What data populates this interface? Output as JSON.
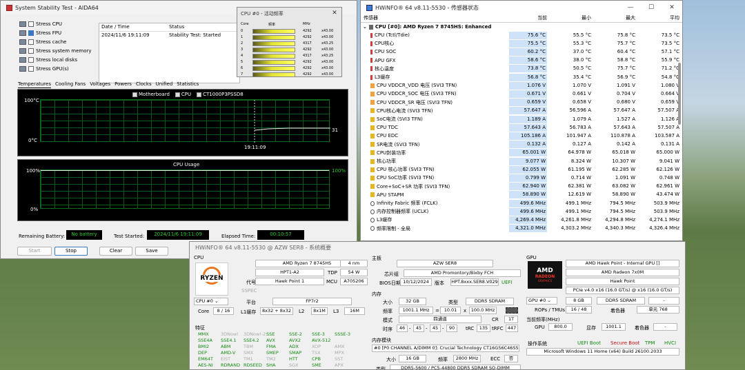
{
  "aida": {
    "title": "System Stability Test - AIDA64",
    "checks": [
      {
        "label": "Stress CPU",
        "on": false
      },
      {
        "label": "Stress FPU",
        "on": true
      },
      {
        "label": "Stress cache",
        "on": false
      },
      {
        "label": "Stress system memory",
        "on": false
      },
      {
        "label": "Stress local disks",
        "on": false
      },
      {
        "label": "Stress GPU(s)",
        "on": false
      }
    ],
    "list_headers": [
      "Date / Time",
      "Status"
    ],
    "list_rows": [
      [
        "2024/11/6 19:11:09",
        "Stability Test: Started"
      ]
    ],
    "tabs": [
      "Temperatures",
      "Cooling Fans",
      "Voltages",
      "Powers",
      "Clocks",
      "Unified",
      "Statistics"
    ],
    "temp_legend": [
      "Motherboard",
      "CPU",
      "CT1000P3PSSD8"
    ],
    "temp_top": "100°C",
    "temp_bottom": "0°C",
    "temp_time": "19:11:09",
    "temp_value": "31",
    "usage_title": "CPU Usage",
    "usage_top": "100%",
    "usage_bottom": "0%",
    "usage_right": "100%",
    "remaining_label": "Remaining Battery:",
    "remaining_value": "No battery",
    "started_label": "Test Started:",
    "started_value": "2024/11/6 19:11:09",
    "elapsed_label": "Elapsed Time:",
    "elapsed_value": "00:10:57",
    "buttons": [
      "Start",
      "Stop",
      "Clear",
      "Save"
    ]
  },
  "cpuact": {
    "title": "CPU #0 - 活动频率",
    "h_core": "Core",
    "h_load": "频率",
    "h_mhz": "MHz",
    "h_ratio": "",
    "rows": [
      [
        "0",
        "4292",
        "x43.00"
      ],
      [
        "1",
        "4292",
        "x43.00"
      ],
      [
        "2",
        "4317",
        "x43.25"
      ],
      [
        "3",
        "4292",
        "x43.00"
      ],
      [
        "4",
        "4317",
        "x43.25"
      ],
      [
        "5",
        "4292",
        "x43.00"
      ],
      [
        "6",
        "4292",
        "x43.00"
      ],
      [
        "7",
        "4292",
        "x43.00"
      ]
    ]
  },
  "hws": {
    "title": "HWiNFO® 64 v8.11-5530 - 传感器状态",
    "headers": [
      "传感器",
      "当前",
      "最小",
      "最大",
      "平均"
    ],
    "group": "CPU [#0]: AMD Ryzen 7 8745HS: Enhanced",
    "rows": [
      [
        "CPU (Tctl/Tdie)",
        "75.6 °C",
        "55.5 °C",
        "75.8 °C",
        "73.5 °C",
        "t"
      ],
      [
        "CPU核心",
        "75.5 °C",
        "55.3 °C",
        "75.7 °C",
        "73.5 °C",
        "t"
      ],
      [
        "CPU SOC",
        "60.2 °C",
        "37.0 °C",
        "60.4 °C",
        "57.1 °C",
        "t"
      ],
      [
        "APU GFX",
        "58.6 °C",
        "38.0 °C",
        "58.8 °C",
        "55.9 °C",
        "t"
      ],
      [
        "核心温度",
        "73.8 °C",
        "50.5 °C",
        "75.7 °C",
        "71.2 °C",
        "t"
      ],
      [
        "L3缓存",
        "56.8 °C",
        "35.4 °C",
        "56.9 °C",
        "54.8 °C",
        "t"
      ],
      [
        "CPU VDDCR_VDD 电压 (SVI3 TFN)",
        "1.076 V",
        "1.070 V",
        "1.091 V",
        "1.080 V",
        "v"
      ],
      [
        "CPU VDDCR_SOC 电压 (SVI3 TFN)",
        "0.671 V",
        "0.661 V",
        "0.704 V",
        "0.664 V",
        "v"
      ],
      [
        "CPU VDDCR_SR 电压 (SVI3 TFN)",
        "0.659 V",
        "0.658 V",
        "0.680 V",
        "0.659 V",
        "v"
      ],
      [
        "CPU核心电流 (SVI3 TFN)",
        "57.647 A",
        "56.596 A",
        "57.647 A",
        "57.507 A",
        "p"
      ],
      [
        "SoC电流 (SVI3 TFN)",
        "1.189 A",
        "1.079 A",
        "1.527 A",
        "1.126 A",
        "p"
      ],
      [
        "CPU TDC",
        "57.643 A",
        "56.783 A",
        "57.643 A",
        "57.507 A",
        "p"
      ],
      [
        "CPU EDC",
        "105.186 A",
        "101.947 A",
        "110.878 A",
        "103.587 A",
        "p"
      ],
      [
        "SR电流 (SVI3 TFN)",
        "0.132 A",
        "0.127 A",
        "0.142 A",
        "0.131 A",
        "p"
      ],
      [
        "CPU封装功率",
        "65.001 W",
        "64.978 W",
        "65.018 W",
        "65.000 W",
        "p"
      ],
      [
        "核心功率",
        "9.077 W",
        "8.324 W",
        "10.307 W",
        "9.041 W",
        "p"
      ],
      [
        "CPU 核心功率 (SVI3 TFN)",
        "62.055 W",
        "61.195 W",
        "62.285 W",
        "62.126 W",
        "p"
      ],
      [
        "CPU SoC功率 (SVI3 TFN)",
        "0.799 W",
        "0.714 W",
        "1.091 W",
        "0.748 W",
        "p"
      ],
      [
        "Core+SoC+SR 功率 (SVI3 TFN)",
        "62.940 W",
        "62.381 W",
        "63.082 W",
        "62.961 W",
        "p"
      ],
      [
        "APU STAPM",
        "58.890 W",
        "12.619 W",
        "58.890 W",
        "43.474 W",
        "p"
      ],
      [
        "Infinity Fabric 频率 (FCLK)",
        "499.6 MHz",
        "499.1 MHz",
        "794.5 MHz",
        "503.9 MHz",
        "f"
      ],
      [
        "内存控制器频率 (UCLK)",
        "499.6 MHz",
        "499.1 MHz",
        "794.5 MHz",
        "503.9 MHz",
        "f"
      ],
      [
        "L3缓存",
        "4,269.4 MHz",
        "4,261.8 MHz",
        "4,294.8 MHz",
        "4,274.1 MHz",
        "f"
      ],
      [
        "频率限制 - 全局",
        "4,321.0 MHz",
        "4,303.2 MHz",
        "4,340.3 MHz",
        "4,326.4 MHz",
        "f"
      ]
    ]
  },
  "sum": {
    "title": "HWiNFO® 64 v8.11-5530 @ AZW SER8 - 系统概要",
    "cpu_sec": "CPU",
    "cpu_name": "AMD Ryzen 7 8745HS",
    "cpu_nm": "4 nm",
    "stepping": "HPT1-A2",
    "tdp_l": "TDP",
    "tdp": "54 W",
    "code_l": "代号",
    "code": "Hawk Point 1",
    "mcu_l": "MCU",
    "mcu": "A705206",
    "sspec_l": "SSPEC",
    "platform_l": "平台",
    "platform": "FP7r2",
    "cpu_sel": "CPU #0",
    "core_l": "Core",
    "core": "8 / 16",
    "l1_l": "L1缓存",
    "l1": "8x32 + 8x32",
    "l2_l": "L2",
    "l2": "8x1M",
    "l3_l": "L3",
    "l3": "16M",
    "feat_l": "特征",
    "feats": [
      [
        "MMX",
        "g"
      ],
      [
        "3DNow!",
        "gr"
      ],
      [
        "3DNow!-2",
        "gr"
      ],
      [
        "SSE",
        "g"
      ],
      [
        "SSE-2",
        "g"
      ],
      [
        "SSE-3",
        "g"
      ],
      [
        "SSSE-3",
        "g"
      ],
      [
        "SSE4A",
        "g"
      ],
      [
        "SSE4.1",
        "g"
      ],
      [
        "SSE4.2",
        "g"
      ],
      [
        "AVX",
        "g"
      ],
      [
        "AVX2",
        "g"
      ],
      [
        "AVX-512",
        "g"
      ],
      [
        "",
        ""
      ],
      [
        "BMI2",
        "g"
      ],
      [
        "ABM",
        "g"
      ],
      [
        "TBM",
        "gr"
      ],
      [
        "FMA",
        "g"
      ],
      [
        "ADX",
        "g"
      ],
      [
        "XOP",
        "gr"
      ],
      [
        "AMX",
        "gr"
      ],
      [
        "DEP",
        "g"
      ],
      [
        "AMD-V",
        "g"
      ],
      [
        "SMX",
        "gr"
      ],
      [
        "SMEP",
        "g"
      ],
      [
        "SMAP",
        "g"
      ],
      [
        "TSX",
        "gr"
      ],
      [
        "MPX",
        "gr"
      ],
      [
        "EM64T",
        "g"
      ],
      [
        "EIST",
        "gr"
      ],
      [
        "TM1",
        "gr"
      ],
      [
        "TM2",
        "gr"
      ],
      [
        "HTT",
        "g"
      ],
      [
        "CPB",
        "g"
      ],
      [
        "SST",
        "gr"
      ],
      [
        "AES-NI",
        "g"
      ],
      [
        "RDRAND",
        "g"
      ],
      [
        "RDSEED",
        "g"
      ],
      [
        "SHA",
        "g"
      ],
      [
        "SGX",
        "gr"
      ],
      [
        "SME",
        "g"
      ],
      [
        "APX",
        "gr"
      ]
    ],
    "mb_sec": "主板",
    "mb": "AZW SER8",
    "chipset_l": "芯片组",
    "chipset": "AMD Promontory/Bixby FCH",
    "bios_l": "BIOS日期",
    "bios": "10/12/2024",
    "ver_l": "版本",
    "ver": "HPT.8xxx.SER8.V029",
    "uefi": "UEFI",
    "mem_sec": "内存",
    "size_l": "大小",
    "size": "32 GB",
    "type_l": "类型",
    "type": "DDR5 SDRAM",
    "freq_l": "频率",
    "freq": "1001.1 MHz",
    "eq": "=",
    "mult": "10.01",
    "x": "x",
    "base": "100.0 MHz",
    "mode_l": "模式",
    "mode": "四通道",
    "cr_l": "CR",
    "cr": "1T",
    "timing_l": "时序",
    "t1": "46",
    "t2": "45",
    "t3": "45",
    "t4": "90",
    "trc_l": "tRC",
    "trc": "135",
    "trfc_l": "tRFC",
    "trfc": "447",
    "module_l": "内存模块",
    "module": "#0 [P0 CHANNEL A/DIMM 0]: Crucial Technology CT16G56C46S5.",
    "msize_l": "大小",
    "msize": "16 GB",
    "mfreq_l": "频率",
    "mfreq": "2800 MHz",
    "ecc_l": "ECC",
    "ecc": "否",
    "mtype_l": "类型",
    "mtype": "DDR5-5600 / PC5-44800 DDR5 SDRAM SO-DIMM",
    "gpu_sec": "GPU",
    "gpu_name": "AMD Hawk Point - Internal GPU []",
    "gpu_model": "AMD Radeon 7x0M",
    "gpu_code": "Hawk Point",
    "gpu_pcie": "PCIe v4.0 x16 (16.0 GT/s) @ x16 (16.0 GT/s)",
    "gpu_sel": "GPU #0",
    "gpu_mem": "8 GB",
    "gpu_memtype": "DDR5 SDRAM",
    "gpu_dash": "-",
    "rops_l": "ROPs / TMUs",
    "rops": "16 / 48",
    "shader_l": "着色器",
    "shader_a": "单元",
    "shader": "768",
    "clk_l": "当前频率(MHz)",
    "gpuclk_l": "GPU",
    "gpuclk": "800.0",
    "memclk_l": "显存",
    "memclk": "1001.1",
    "shclk_l": "着色器",
    "shclk": "-",
    "os_l": "操作系统",
    "uefi_boot": "UEFI Boot",
    "secure": "Secure Boot",
    "tpm": "TPM",
    "hvci": "HVCI",
    "os": "Microsoft Windows 11 Home (x64) Build 26100.2033",
    "ryzen": "RYZEN",
    "amd": "AMD",
    "radeon": "RADEON",
    "graphics": "GRAPHICS"
  }
}
